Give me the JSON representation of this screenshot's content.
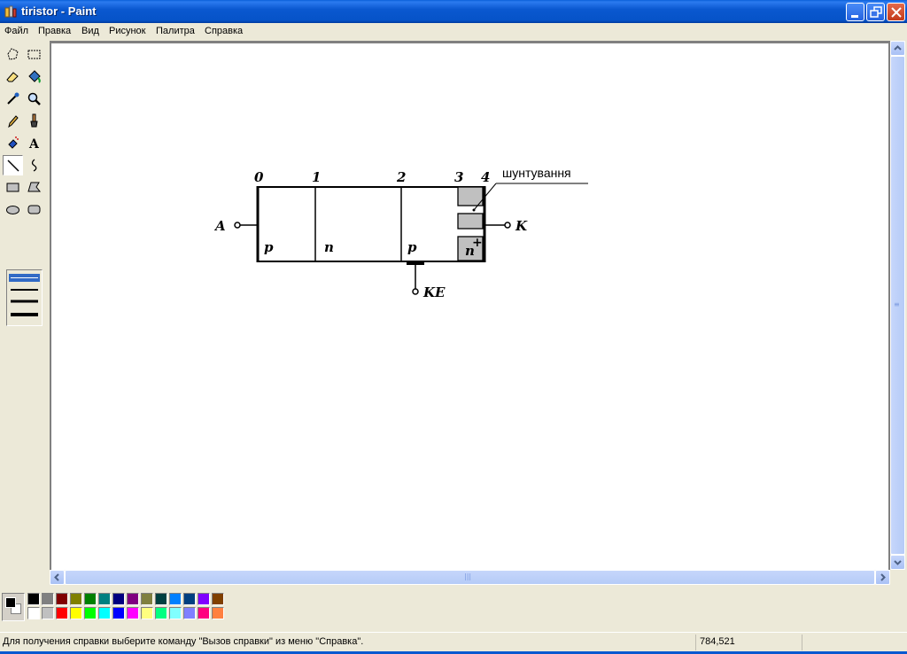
{
  "window": {
    "title": "tiristor - Paint",
    "app_icon": "paint-icon",
    "controls": [
      "minimize-icon",
      "restore-icon",
      "close-icon"
    ],
    "titlebar_color": "#0a58d0"
  },
  "menu": {
    "items": [
      "Файл",
      "Правка",
      "Вид",
      "Рисунок",
      "Палитра",
      "Справка"
    ]
  },
  "toolbox": {
    "tools": [
      {
        "name": "free-select-icon"
      },
      {
        "name": "rect-select-icon"
      },
      {
        "name": "eraser-icon"
      },
      {
        "name": "fill-icon"
      },
      {
        "name": "color-picker-icon"
      },
      {
        "name": "magnifier-icon"
      },
      {
        "name": "pencil-icon"
      },
      {
        "name": "brush-icon"
      },
      {
        "name": "airbrush-icon"
      },
      {
        "name": "text-icon",
        "glyph": "A"
      },
      {
        "name": "line-icon",
        "active": true
      },
      {
        "name": "curve-icon"
      },
      {
        "name": "rectangle-icon"
      },
      {
        "name": "polygon-icon"
      },
      {
        "name": "ellipse-icon"
      },
      {
        "name": "rounded-rect-icon"
      }
    ],
    "line_widths": [
      1,
      2,
      3,
      4
    ],
    "selected_width": 1,
    "selection_color": "#316ac5"
  },
  "drawing": {
    "terminals": {
      "anode": "A",
      "cathode": "K",
      "control": "KE"
    },
    "boundaries": [
      "0",
      "1",
      "2",
      "3",
      "4"
    ],
    "layers": [
      "p",
      "n",
      "p",
      "n"
    ],
    "layer_superscript": "+",
    "annotation": "шунтування",
    "fill_gray": "#c0c0c0"
  },
  "palette": {
    "foreground": "#000000",
    "background": "#ffffff",
    "row1": [
      "#000000",
      "#808080",
      "#800000",
      "#808000",
      "#008000",
      "#008080",
      "#000080",
      "#800080",
      "#808040",
      "#004040",
      "#0080ff",
      "#004080",
      "#8000ff",
      "#804000"
    ],
    "row2": [
      "#ffffff",
      "#c0c0c0",
      "#ff0000",
      "#ffff00",
      "#00ff00",
      "#00ffff",
      "#0000ff",
      "#ff00ff",
      "#ffff80",
      "#00ff80",
      "#80ffff",
      "#8080ff",
      "#ff0080",
      "#ff8040"
    ]
  },
  "status": {
    "help_text": "Для получения справки выберите команду \"Вызов справки\" из меню \"Справка\".",
    "coords": "784,521"
  }
}
